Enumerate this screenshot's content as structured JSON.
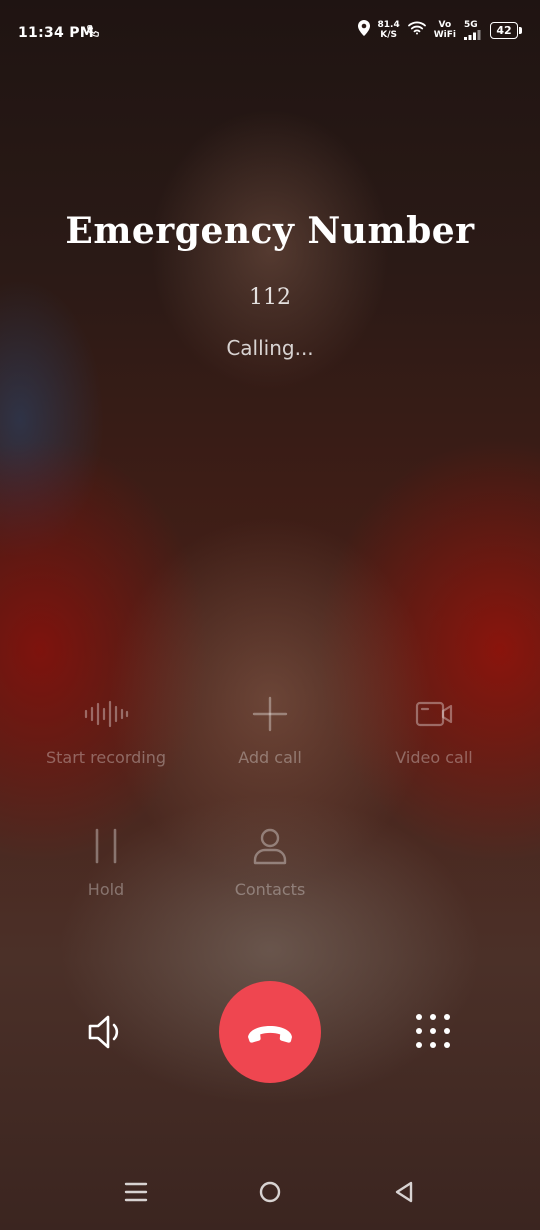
{
  "status_bar": {
    "time": "11:34 PM",
    "net_speed_value": "81.4",
    "net_speed_unit": "K/S",
    "vo_label": "Vo",
    "wifi_label": "WiFi",
    "network_type": "5G",
    "battery_level": "42"
  },
  "call": {
    "name": "Emergency Number",
    "number": "112",
    "status": "Calling..."
  },
  "actions": [
    {
      "label": "Start recording",
      "icon": "waveform-icon",
      "enabled": false
    },
    {
      "label": "Add call",
      "icon": "plus-icon",
      "enabled": false
    },
    {
      "label": "Video call",
      "icon": "video-camera-icon",
      "enabled": false
    },
    {
      "label": "Hold",
      "icon": "pause-icon",
      "enabled": false
    },
    {
      "label": "Contacts",
      "icon": "person-icon",
      "enabled": false
    }
  ],
  "controls": {
    "speaker_icon": "speaker-icon",
    "end_call_icon": "phone-hangup-icon",
    "end_call_color": "#ef4650",
    "dialpad_icon": "dialpad-icon"
  },
  "nav": {
    "menu_icon": "menu-icon",
    "home_icon": "home-icon",
    "back_icon": "back-icon"
  }
}
